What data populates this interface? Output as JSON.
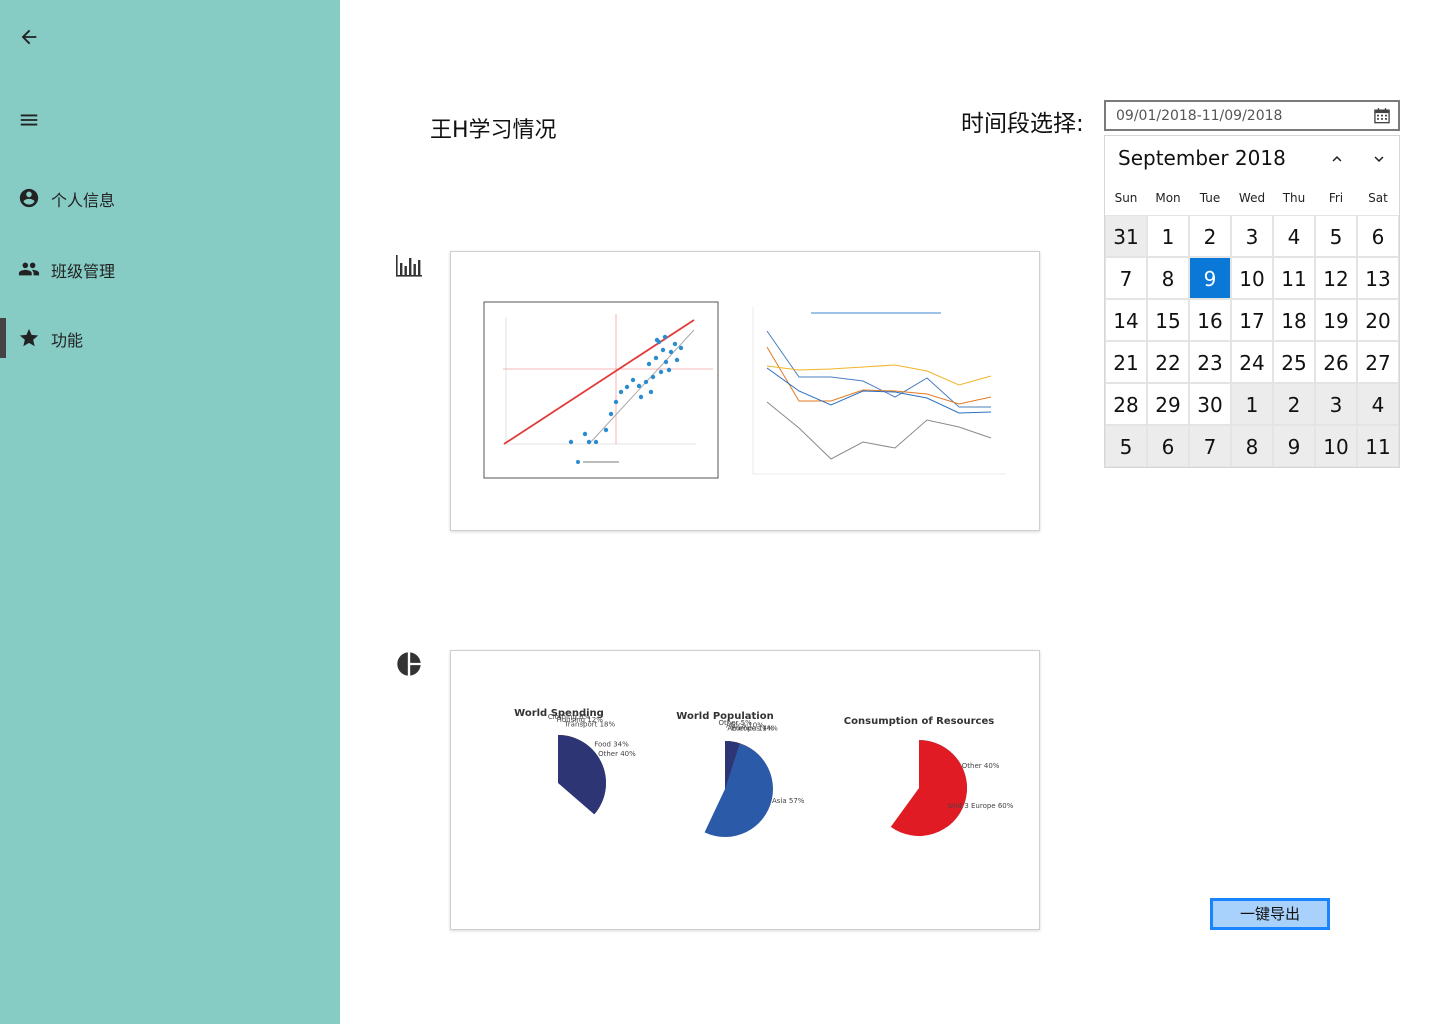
{
  "sidebar": {
    "items": [
      {
        "label": "个人信息",
        "icon": "account-circle-icon"
      },
      {
        "label": "班级管理",
        "icon": "group-icon"
      },
      {
        "label": "功能",
        "icon": "star-icon",
        "active": true
      }
    ]
  },
  "main": {
    "title": "王H学习情况",
    "range_label": "时间段选择:",
    "date_range": "09/01/2018-11/09/2018",
    "export_label": "一键导出"
  },
  "calendar": {
    "month_title": "September 2018",
    "weekdays": [
      "Sun",
      "Mon",
      "Tue",
      "Wed",
      "Thu",
      "Fri",
      "Sat"
    ],
    "weeks": [
      [
        "31",
        "1",
        "2",
        "3",
        "4",
        "5",
        "6"
      ],
      [
        "7",
        "8",
        "9",
        "10",
        "11",
        "12",
        "13"
      ],
      [
        "14",
        "15",
        "16",
        "17",
        "18",
        "19",
        "20"
      ],
      [
        "21",
        "22",
        "23",
        "24",
        "25",
        "26",
        "27"
      ],
      [
        "28",
        "29",
        "30",
        "1",
        "2",
        "3",
        "4"
      ],
      [
        "5",
        "6",
        "7",
        "8",
        "9",
        "10",
        "11"
      ]
    ],
    "selected_day": "9",
    "accent": "#0a78d7"
  },
  "charts": {
    "spending": {
      "title": "World Spending",
      "slices": [
        {
          "label": "Food",
          "value": 34,
          "color": "#1ba3c6"
        },
        {
          "label": "Clothing",
          "value": 6,
          "color": "#e01b24"
        },
        {
          "label": "Housing",
          "value": 12,
          "color": "#f06418"
        },
        {
          "label": "Transport",
          "value": 18,
          "color": "#2b5aa8"
        },
        {
          "label": "Other",
          "value": 40,
          "color": "#2e3575"
        }
      ]
    },
    "population": {
      "title": "World Population",
      "slices": [
        {
          "label": "Europe",
          "value": 14,
          "color": "#1ba3c6"
        },
        {
          "label": "Americas",
          "value": 14,
          "color": "#e01b24"
        },
        {
          "label": "Africa",
          "value": 10,
          "color": "#f06418"
        },
        {
          "label": "Asia",
          "value": 57,
          "color": "#2b5aa8"
        },
        {
          "label": "Other",
          "value": 5,
          "color": "#2e3575"
        }
      ]
    },
    "resources": {
      "title": "Consumption of Resources",
      "slices": [
        {
          "label": "Other",
          "value": 40,
          "color": "#1ba3c6"
        },
        {
          "label": "Unit 3 Europe",
          "value": 60,
          "color": "#e01b24"
        }
      ]
    }
  }
}
